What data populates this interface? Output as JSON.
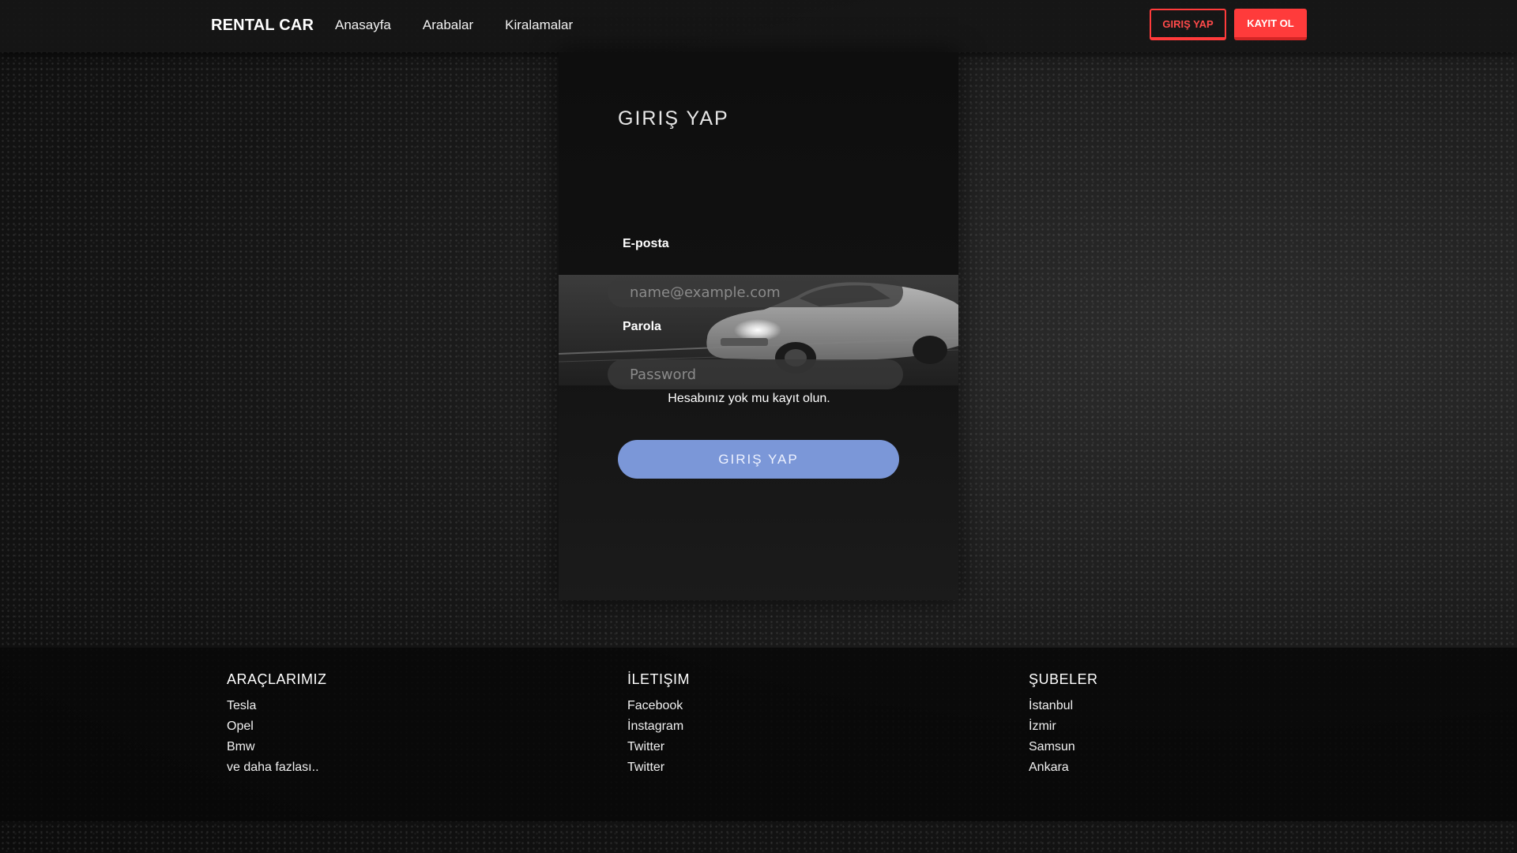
{
  "navbar": {
    "brand": "RENTAL CAR",
    "links": [
      "Anasayfa",
      "Arabalar",
      "Kiralamalar"
    ],
    "login_button": "GIRIŞ YAP",
    "register_button": "KAYIT OL"
  },
  "login_form": {
    "title": "GIRIŞ YAP",
    "email_label": "E-posta",
    "email_placeholder": "name@example.com",
    "password_label": "Parola",
    "password_placeholder": "Password",
    "register_prompt": "Hesabınız yok mu kayıt olun.",
    "submit_label": "GIRIŞ YAP"
  },
  "footer": {
    "columns": [
      {
        "heading": "ARAÇLARIMIZ",
        "items": [
          "Tesla",
          "Opel",
          "Bmw",
          "ve daha fazlası.."
        ]
      },
      {
        "heading": "İLETIŞIM",
        "items": [
          "Facebook",
          "İnstagram",
          "Twitter",
          "Twitter"
        ]
      },
      {
        "heading": "ŞUBELER",
        "items": [
          "İstanbul",
          "İzmir",
          "Samsun",
          "Ankara"
        ]
      }
    ]
  },
  "colors": {
    "accent_red": "#ff3b3b",
    "submit_blue": "#7b97d8",
    "background": "#141414"
  }
}
